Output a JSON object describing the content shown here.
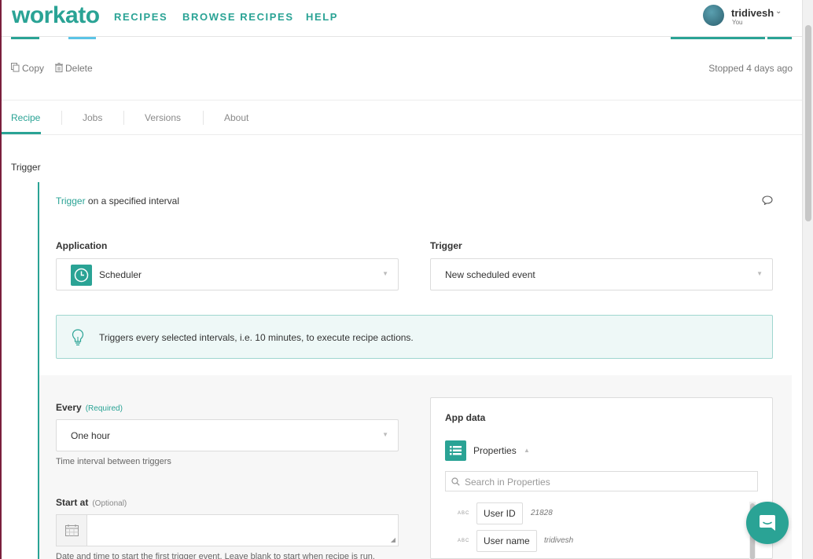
{
  "header": {
    "logo": "workato",
    "nav": [
      "RECIPES",
      "BROWSE RECIPES",
      "HELP"
    ],
    "user": {
      "name": "tridivesh",
      "sub": "You"
    }
  },
  "toolbar": {
    "copy": "Copy",
    "delete": "Delete",
    "status": "Stopped 4 days ago"
  },
  "tabs": [
    "Recipe",
    "Jobs",
    "Versions",
    "About"
  ],
  "section_label": "Trigger",
  "trigger_card": {
    "head_link": "Trigger",
    "head_rest": " on a specified interval",
    "application": {
      "label": "Application",
      "value": "Scheduler"
    },
    "trigger": {
      "label": "Trigger",
      "value": "New scheduled event"
    },
    "info": "Triggers every selected intervals, i.e. 10 minutes, to execute recipe actions.",
    "every": {
      "label": "Every",
      "required": "(Required)",
      "value": "One hour",
      "hint": "Time interval between triggers"
    },
    "start_at": {
      "label": "Start at",
      "optional": "(Optional)",
      "hint": "Date and time to start the first trigger event. Leave blank to start when recipe is run."
    }
  },
  "app_data": {
    "title": "App data",
    "properties": "Properties",
    "search_placeholder": "Search in Properties",
    "pills": [
      {
        "type": "ABC",
        "label": "User ID",
        "sample": "21828"
      },
      {
        "type": "ABC",
        "label": "User name",
        "sample": "tridivesh"
      }
    ]
  },
  "colors": {
    "accent": "#2aa395"
  }
}
